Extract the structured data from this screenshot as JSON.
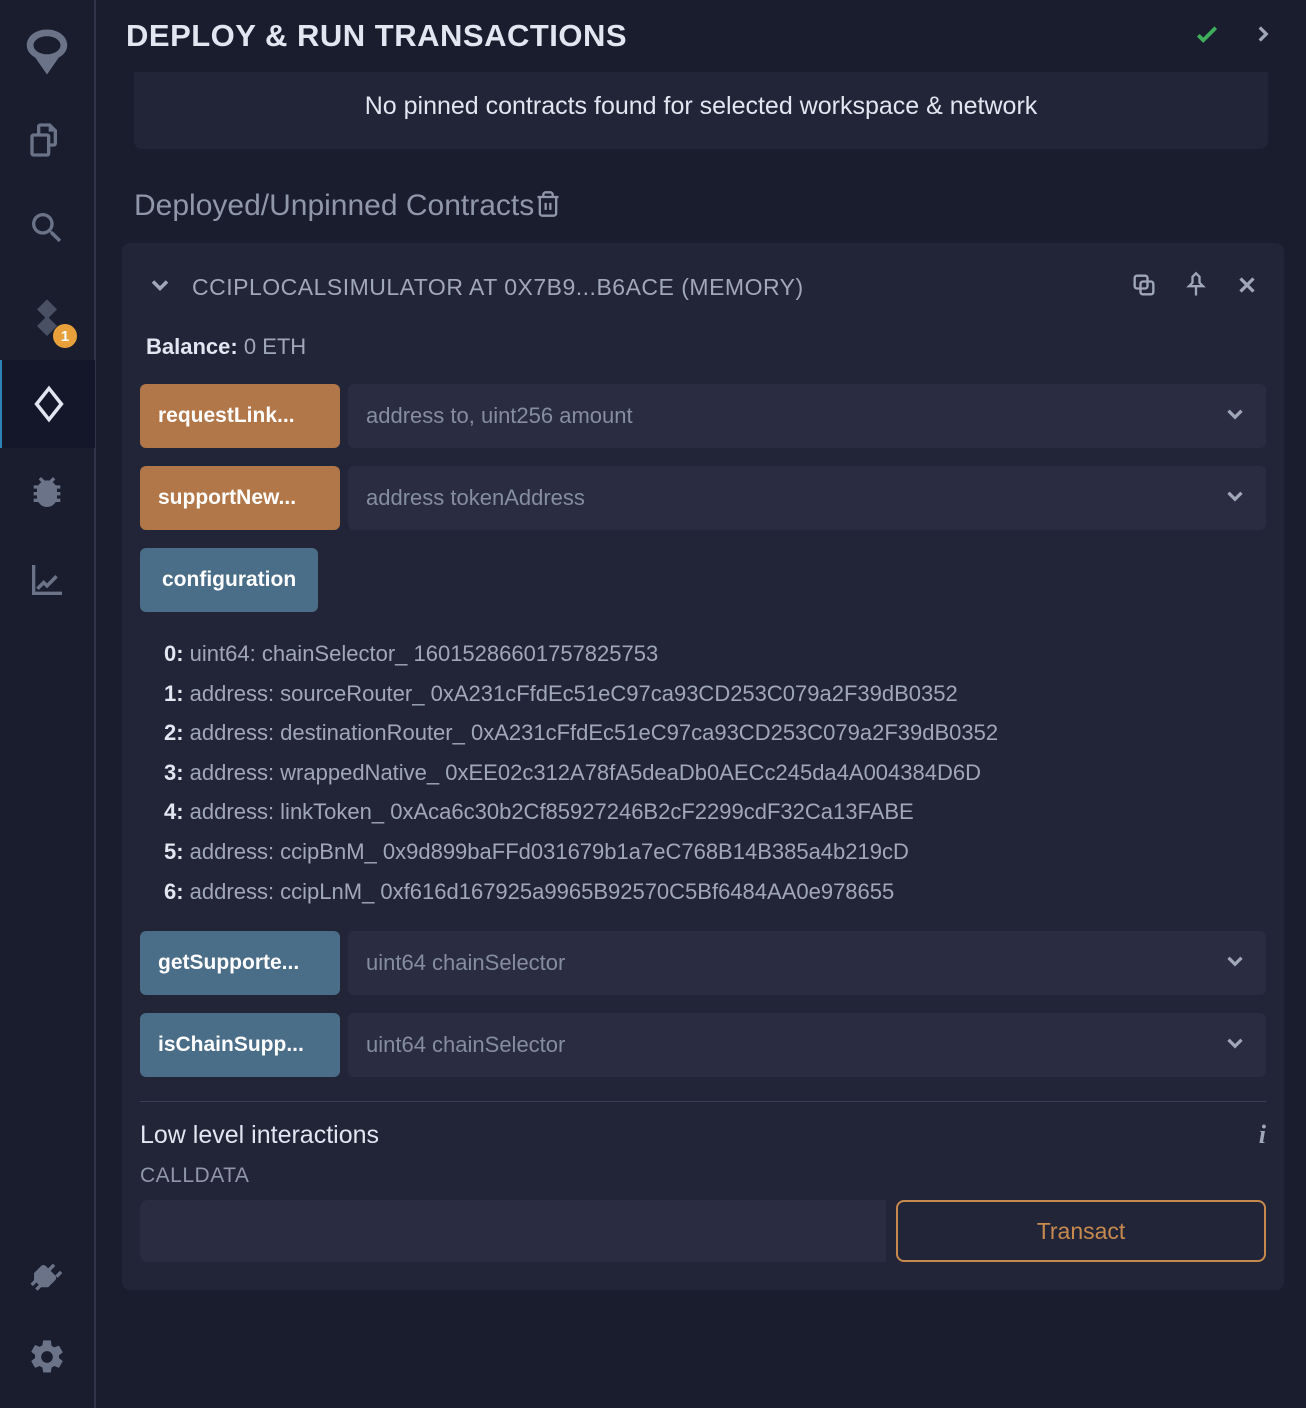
{
  "header": {
    "title": "DEPLOY & RUN TRANSACTIONS"
  },
  "notice": "No pinned contracts found for selected workspace & network",
  "section": {
    "deployed_title": "Deployed/Unpinned Contracts"
  },
  "sidebar": {
    "badge": "1"
  },
  "contract": {
    "name": "CCIPLOCALSIMULATOR AT 0X7B9...B6ACE (MEMORY)",
    "balance_label": "Balance:",
    "balance_value": "0 ETH",
    "functions": {
      "requestLink": {
        "label": "requestLink...",
        "placeholder": "address to, uint256 amount"
      },
      "supportNew": {
        "label": "supportNew...",
        "placeholder": "address tokenAddress"
      },
      "configuration": {
        "label": "configuration"
      },
      "getSupported": {
        "label": "getSupporte...",
        "placeholder": "uint64 chainSelector"
      },
      "isChainSupported": {
        "label": "isChainSupp...",
        "placeholder": "uint64 chainSelector"
      }
    },
    "config_output": [
      {
        "idx": "0:",
        "text": " uint64: chainSelector_ 16015286601757825753"
      },
      {
        "idx": "1:",
        "text": " address: sourceRouter_ 0xA231cFfdEc51eC97ca93CD253C079a2F39dB0352"
      },
      {
        "idx": "2:",
        "text": " address: destinationRouter_ 0xA231cFfdEc51eC97ca93CD253C079a2F39dB0352"
      },
      {
        "idx": "3:",
        "text": " address: wrappedNative_ 0xEE02c312A78fA5deaDb0AECc245da4A004384D6D"
      },
      {
        "idx": "4:",
        "text": " address: linkToken_ 0xAca6c30b2Cf85927246B2cF2299cdF32Ca13FABE"
      },
      {
        "idx": "5:",
        "text": " address: ccipBnM_ 0x9d899baFFd031679b1a7eC768B14B385a4b219cD"
      },
      {
        "idx": "6:",
        "text": " address: ccipLnM_ 0xf616d167925a9965B92570C5Bf6484AA0e978655"
      }
    ]
  },
  "low_level": {
    "title": "Low level interactions",
    "calldata_label": "CALLDATA",
    "transact_label": "Transact"
  }
}
